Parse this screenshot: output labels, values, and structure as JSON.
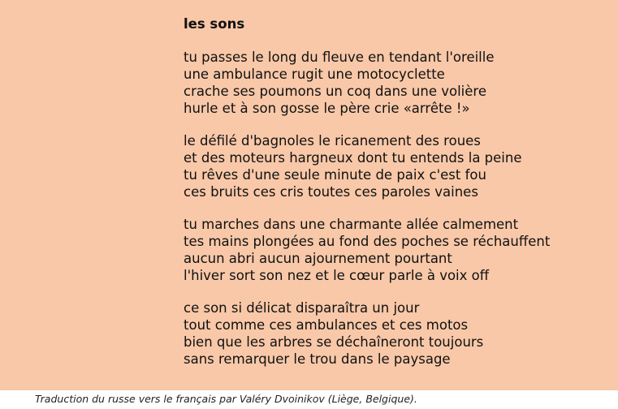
{
  "poem": {
    "title": "les sons",
    "stanzas": [
      [
        "tu passes le long du fleuve en tendant l'oreille",
        "une ambulance rugit une motocyclette",
        "crache ses poumons un coq dans une volière",
        "hurle et à son gosse le père crie «arrête !»"
      ],
      [
        "le défilé d'bagnoles le ricanement des roues",
        "et des moteurs hargneux dont tu entends la peine",
        "tu rêves d'une seule minute de paix c'est fou",
        "ces bruits ces cris toutes ces paroles vaines"
      ],
      [
        "tu marches dans une charmante allée calmement",
        "tes mains plongées au fond des poches se réchauffent",
        "aucun abri aucun ajournement pourtant",
        "l'hiver sort son nez et le cœur parle à voix off"
      ],
      [
        "ce son si délicat disparaîtra un jour",
        "tout comme ces ambulances et ces motos",
        "bien que les arbres se déchaîneront toujours",
        "sans remarquer le trou dans le paysage"
      ]
    ]
  },
  "footer": {
    "translation_note": "Traduction du russe vers le français par Valéry Dvoinikov (Liège, Belgique)."
  },
  "colors": {
    "panel_background": "#f8c8a8",
    "text": "#111111"
  }
}
